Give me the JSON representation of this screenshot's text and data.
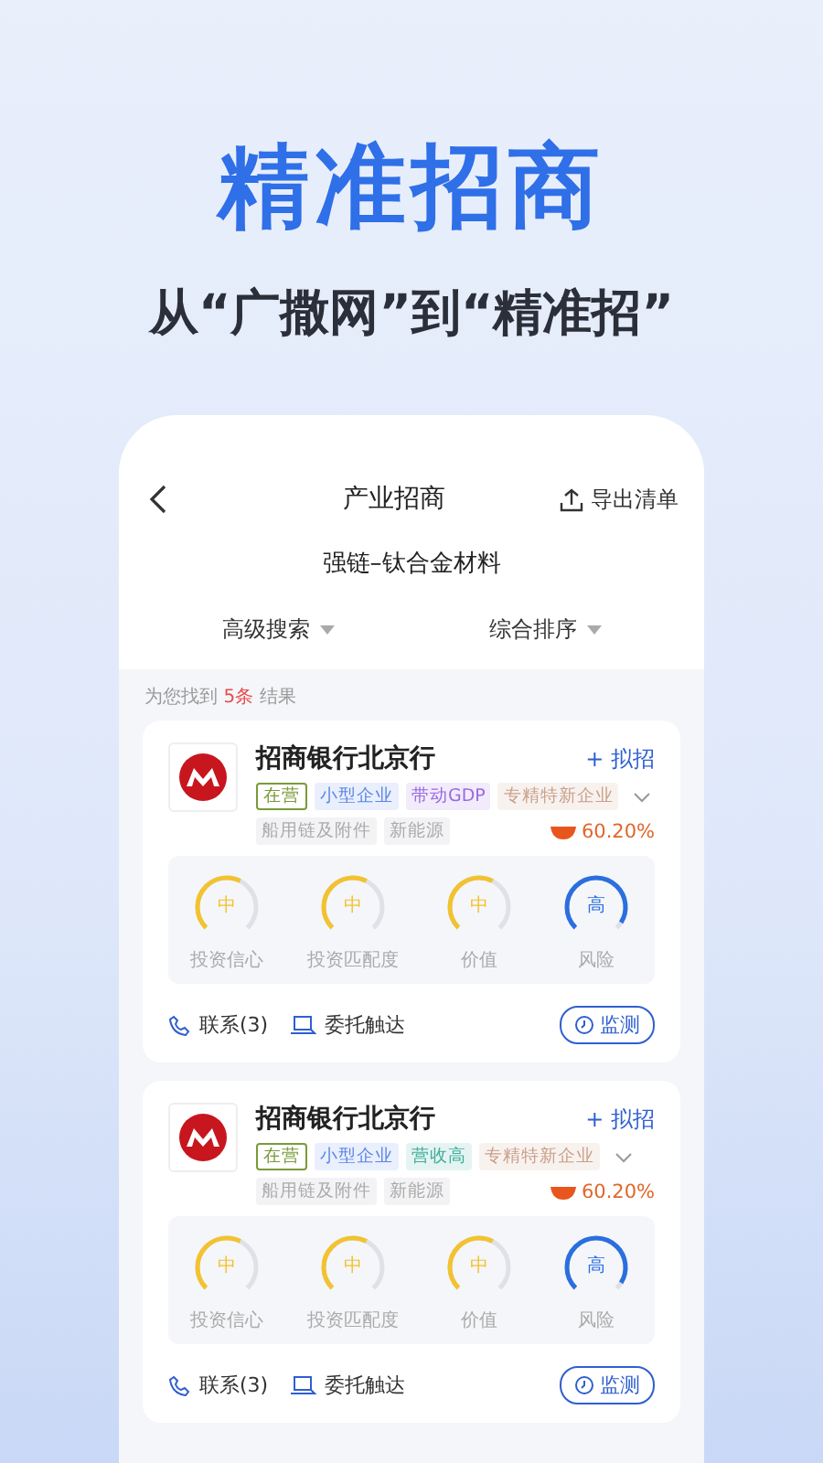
{
  "headline": "精准招商",
  "subheadline": "从“广撒网”到“精准招”",
  "screen": {
    "title": "产业招商",
    "export_label": "导出清单",
    "subtitle": "强链–钛合金材料",
    "filters": [
      {
        "label": "高级搜索"
      },
      {
        "label": "综合排序"
      }
    ],
    "result": {
      "prefix": "为您找到",
      "count": "5条",
      "suffix": "结果"
    },
    "cards": [
      {
        "name": "招商银行北京行",
        "action": "+ 拟招",
        "tags": [
          {
            "label": "在营",
            "kind": "outline",
            "color": "#7a9a3a"
          },
          {
            "label": "小型企业",
            "kind": "fill",
            "color": "#5b86e5"
          },
          {
            "label": "带动GDP",
            "kind": "fill",
            "color": "#9a6be0"
          },
          {
            "label": "专精特新企业",
            "kind": "fill",
            "color": "#c9a08a"
          }
        ],
        "industries": [
          "船用链及附件",
          "新能源"
        ],
        "score": "60.20%",
        "gauges": [
          {
            "value": "中",
            "label": "投资信心",
            "level": 0.6,
            "color": "#f2c230"
          },
          {
            "value": "中",
            "label": "投资匹配度",
            "level": 0.6,
            "color": "#f2c230"
          },
          {
            "value": "中",
            "label": "价值",
            "level": 0.6,
            "color": "#f2c230"
          },
          {
            "value": "高",
            "label": "风险",
            "level": 0.95,
            "color": "#2a6fe0"
          }
        ],
        "contact": "联系(3)",
        "delegate": "委托触达",
        "monitor": "监测"
      },
      {
        "name": "招商银行北京行",
        "action": "+ 拟招",
        "tags": [
          {
            "label": "在营",
            "kind": "outline",
            "color": "#7a9a3a"
          },
          {
            "label": "小型企业",
            "kind": "fill",
            "color": "#5b86e5"
          },
          {
            "label": "营收高",
            "kind": "fill",
            "color": "#3fae9a"
          },
          {
            "label": "专精特新企业",
            "kind": "fill",
            "color": "#c9a08a"
          }
        ],
        "industries": [
          "船用链及附件",
          "新能源"
        ],
        "score": "60.20%",
        "gauges": [
          {
            "value": "中",
            "label": "投资信心",
            "level": 0.6,
            "color": "#f2c230"
          },
          {
            "value": "中",
            "label": "投资匹配度",
            "level": 0.6,
            "color": "#f2c230"
          },
          {
            "value": "中",
            "label": "价值",
            "level": 0.6,
            "color": "#f2c230"
          },
          {
            "value": "高",
            "label": "风险",
            "level": 0.95,
            "color": "#2a6fe0"
          }
        ],
        "contact": "联系(3)",
        "delegate": "委托触达",
        "monitor": "监测"
      }
    ]
  }
}
